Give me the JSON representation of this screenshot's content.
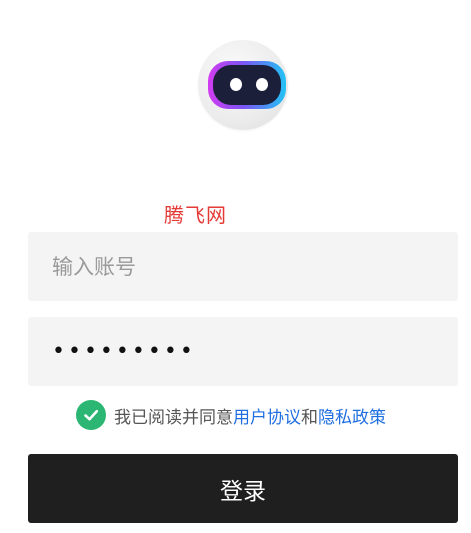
{
  "logo": {
    "icon": "robot-avatar-icon"
  },
  "site_name": "腾飞网",
  "username": {
    "placeholder": "输入账号",
    "value": ""
  },
  "password": {
    "value": "•••••••••"
  },
  "agreement": {
    "checked": true,
    "prefix": "我已阅读并同意",
    "user_agreement": "用户协议",
    "and": "和",
    "privacy_policy": "隐私政策"
  },
  "login_button": {
    "label": "登录"
  },
  "colors": {
    "site_name": "#e53935",
    "check": "#2bb673",
    "link": "#1f6fe0",
    "button": "#1f1f1f"
  }
}
